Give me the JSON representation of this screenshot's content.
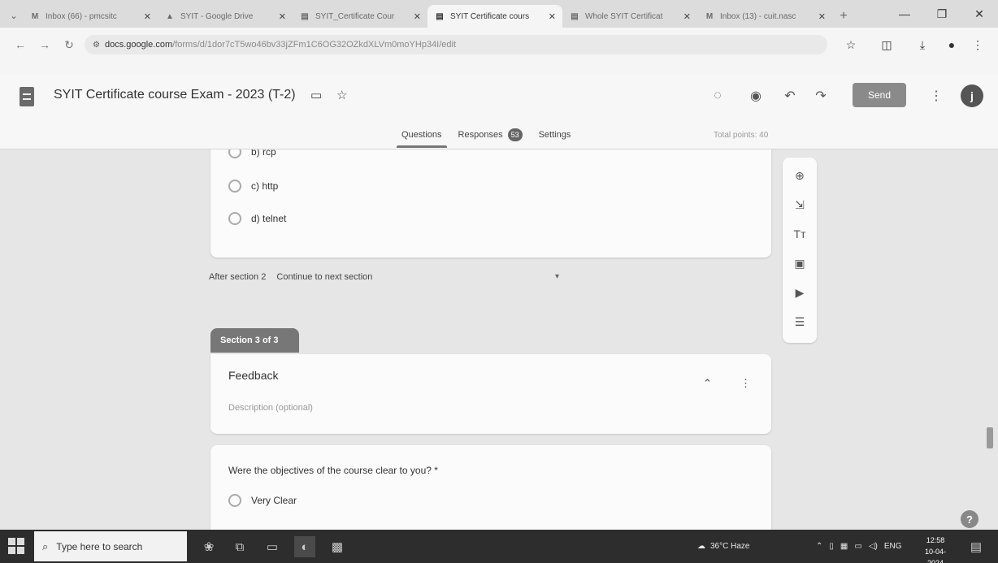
{
  "browser": {
    "tabs": [
      {
        "icon": "gmail-icon",
        "glyph": "M",
        "title": "Inbox (66) - pmcsitc",
        "active": false
      },
      {
        "icon": "drive-icon",
        "glyph": "▲",
        "title": "SYIT - Google Drive",
        "active": false
      },
      {
        "icon": "forms-icon",
        "glyph": "▤",
        "title": "SYIT_Certificate Cour",
        "active": false
      },
      {
        "icon": "forms-icon",
        "glyph": "▤",
        "title": "SYIT Certificate cours",
        "active": true
      },
      {
        "icon": "forms-icon",
        "glyph": "▤",
        "title": "Whole SYIT Certificat",
        "active": false
      },
      {
        "icon": "gmail-icon",
        "glyph": "M",
        "title": "Inbox (13) - cuit.nasc",
        "active": false
      }
    ],
    "url_host": "docs.google.com",
    "url_path": "/forms/d/1dor7cT5wo46bv33jZFm1C6OG32OZkdXLVm0moYHp34I/edit"
  },
  "forms_header": {
    "title": "SYIT Certificate course Exam - 2023 (T-2)",
    "send_label": "Send",
    "avatar_initial": "j",
    "tabs": {
      "questions": "Questions",
      "responses": "Responses",
      "settings": "Settings"
    },
    "responses_count": "53",
    "total_points": "Total points: 40"
  },
  "section2": {
    "options": [
      "b) rcp",
      "c) http",
      "d) telnet"
    ],
    "after_label": "After section 2",
    "after_value": "Continue to next section"
  },
  "section3": {
    "tab_label": "Section 3 of 3",
    "title": "Feedback",
    "description_placeholder": "Description (optional)"
  },
  "question": {
    "text": "Were the objectives of the course clear to you? *",
    "options": [
      "Very Clear"
    ]
  },
  "taskbar": {
    "search_placeholder": "Type here to search",
    "weather": "36°C Haze",
    "language": "ENG",
    "time": "12:58",
    "date": "10-04-2024"
  }
}
